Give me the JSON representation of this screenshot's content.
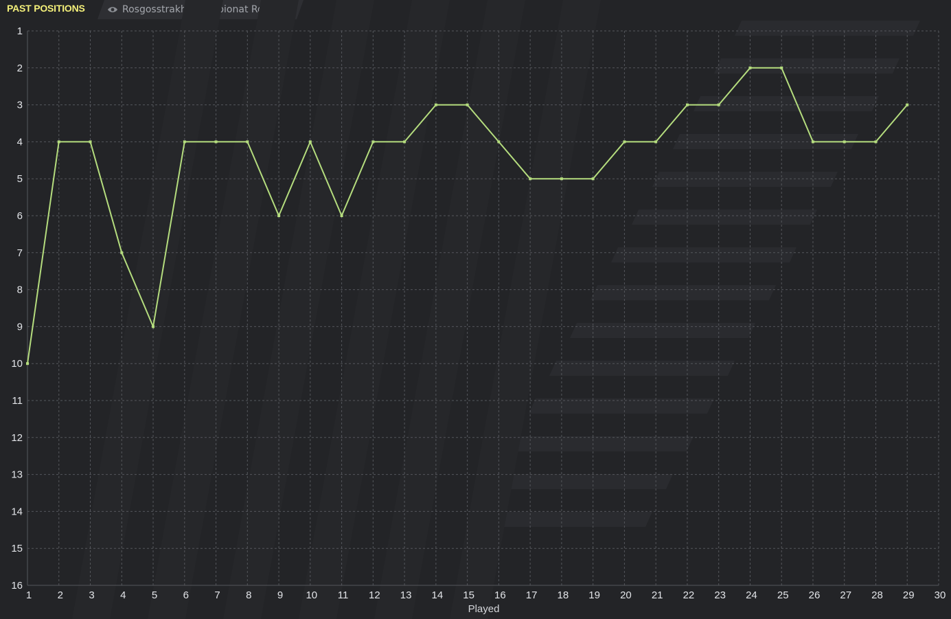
{
  "header": {
    "title": "PAST POSITIONS",
    "competition": "Rosgosstrakh Chempionat Rossii",
    "competition_icon": "eye-icon",
    "dropdown_icon": "chevron-down-icon"
  },
  "colors": {
    "background": "#232427",
    "title": "#f4f07a",
    "line": "#b5dd7e",
    "grid": "#55575c"
  },
  "chart_data": {
    "type": "line",
    "title": "",
    "xlabel": "Played",
    "ylabel": "",
    "x": [
      1,
      2,
      3,
      4,
      5,
      6,
      7,
      8,
      9,
      10,
      11,
      12,
      13,
      14,
      15,
      16,
      17,
      18,
      19,
      20,
      21,
      22,
      23,
      24,
      25,
      26,
      27,
      28,
      29
    ],
    "series": [
      {
        "values": [
          10,
          4,
          4,
          7,
          9,
          4,
          4,
          4,
          6,
          4,
          6,
          4,
          4,
          3,
          3,
          4,
          5,
          5,
          5,
          4,
          4,
          3,
          3,
          2,
          2,
          4,
          4,
          4,
          3
        ]
      }
    ],
    "xlim": [
      1,
      30
    ],
    "ylim": [
      1,
      16
    ],
    "y_inverted": true,
    "x_ticks": [
      1,
      2,
      3,
      4,
      5,
      6,
      7,
      8,
      9,
      10,
      11,
      12,
      13,
      14,
      15,
      16,
      17,
      18,
      19,
      20,
      21,
      22,
      23,
      24,
      25,
      26,
      27,
      28,
      29,
      30
    ],
    "y_ticks": [
      1,
      2,
      3,
      4,
      5,
      6,
      7,
      8,
      9,
      10,
      11,
      12,
      13,
      14,
      15,
      16
    ],
    "grid": true,
    "grid_style": "dashed",
    "legend": "none"
  }
}
